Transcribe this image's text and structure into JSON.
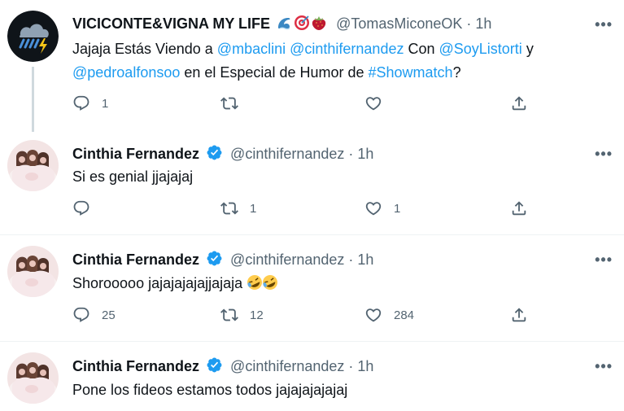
{
  "tweets": [
    {
      "name": "VICICONTE&VIGNA MY LIFE",
      "name_emojis": [
        "wave-emoji",
        "target-emoji",
        "strawberry-emoji"
      ],
      "handle": "@TomasMiconeOK",
      "sep": "·",
      "time": "1h",
      "body_parts": [
        {
          "t": "Jajaja Estás Viendo a ",
          "link": false
        },
        {
          "t": "@mbaclini",
          "link": true
        },
        {
          "t": " ",
          "link": false
        },
        {
          "t": "@cinthifernandez",
          "link": true
        },
        {
          "t": " Con ",
          "link": false
        },
        {
          "t": "@SoyListorti",
          "link": true
        },
        {
          "t": " y ",
          "link": false
        },
        {
          "t": "@pedroalfonsoo",
          "link": true
        },
        {
          "t": " en el Especial de Humor de ",
          "link": false
        },
        {
          "t": "#Showmatch",
          "link": true
        },
        {
          "t": "?",
          "link": false
        }
      ],
      "reply_count": "1",
      "retweet_count": "",
      "like_count": ""
    },
    {
      "name": "Cinthia Fernandez",
      "verified": true,
      "handle": "@cinthifernandez",
      "sep": "·",
      "time": "1h",
      "body": "Si es genial jjajajaj",
      "reply_count": "",
      "retweet_count": "1",
      "like_count": "1"
    },
    {
      "name": "Cinthia Fernandez",
      "verified": true,
      "handle": "@cinthifernandez",
      "sep": "·",
      "time": "1h",
      "body": "Shorooooo jajajajajajjajaja",
      "body_emojis": [
        "rofl-emoji",
        "rofl-emoji"
      ],
      "reply_count": "25",
      "retweet_count": "12",
      "like_count": "284"
    },
    {
      "name": "Cinthia Fernandez",
      "verified": true,
      "handle": "@cinthifernandez",
      "sep": "·",
      "time": "1h",
      "body": "Pone los fideos estamos todos jajajajajajaj"
    }
  ],
  "more_label": "•••",
  "colors": {
    "link": "#1d9bf0",
    "muted": "#536471",
    "verified": "#1d9bf0",
    "divider": "#eff3f4"
  }
}
